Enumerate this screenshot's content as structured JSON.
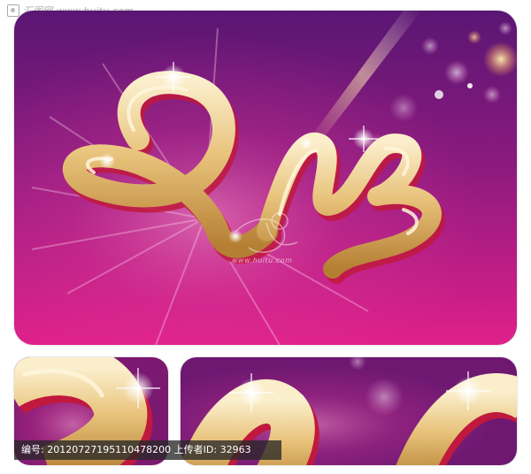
{
  "watermark": {
    "site_name": "汇图网",
    "site_url": "www.huitu.com",
    "center_url": "www.huitu.com"
  },
  "footer": {
    "text": "编号: 20120727195110478200 上传者ID: 32963"
  },
  "colors": {
    "background_top": "#5a1673",
    "background_bottom": "#e0208a",
    "gold_light": "#f7e3b0",
    "gold_mid": "#e2b866",
    "gold_dark": "#b07a2c",
    "shadow_red": "#c0193d"
  },
  "artwork": {
    "subject": "golden calligraphic 2013 on magenta background",
    "panels": [
      "main",
      "detail-left",
      "detail-right"
    ]
  }
}
